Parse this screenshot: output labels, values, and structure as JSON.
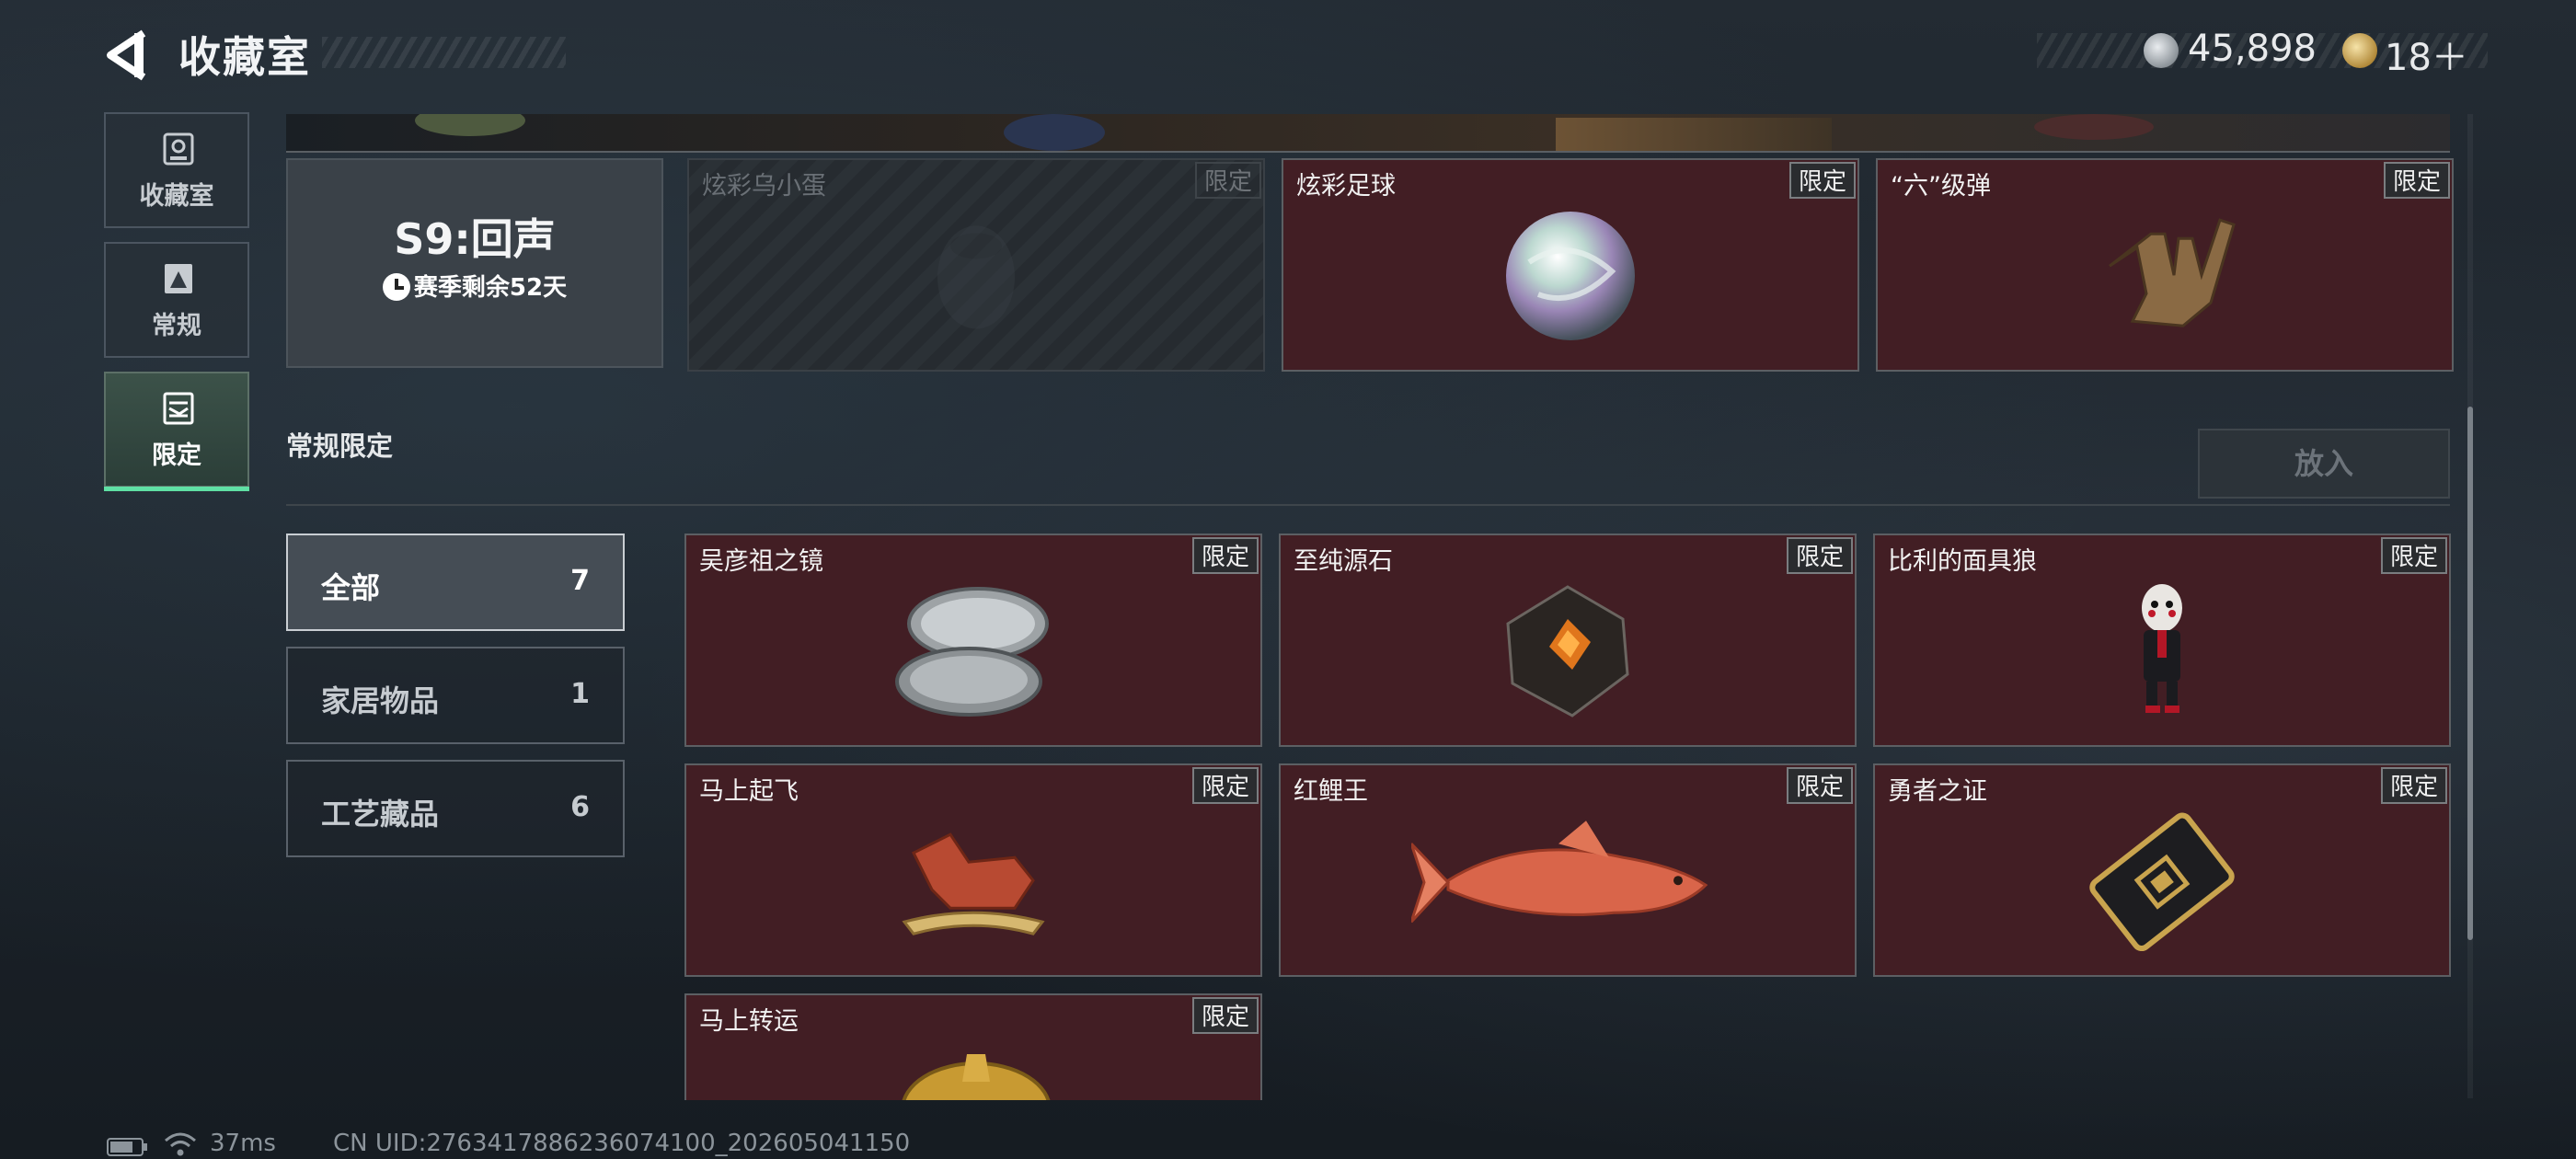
{
  "header": {
    "title": "收藏室",
    "currency": [
      {
        "icon": "silver-coin-icon",
        "value": "45,898"
      },
      {
        "icon": "gold-token-icon",
        "value": "18＋"
      }
    ]
  },
  "nav": [
    {
      "label": "收藏室",
      "icon": "collection-room-icon"
    },
    {
      "label": "常规",
      "icon": "regular-icon"
    },
    {
      "label": "限定",
      "icon": "limited-icon",
      "active": true
    }
  ],
  "season": {
    "title": "S9:回声",
    "remaining": "赛季剩余52天"
  },
  "top_cards": [
    {
      "name": "炫彩乌小蛋",
      "tag": "限定",
      "locked": true
    },
    {
      "name": "炫彩足球",
      "tag": "限定"
    },
    {
      "name": "“六”级弹",
      "tag": "限定"
    }
  ],
  "section": {
    "title": "常规限定",
    "place_button": "放入"
  },
  "categories": [
    {
      "label": "全部",
      "count": "7",
      "selected": true
    },
    {
      "label": "家居物品",
      "count": "1"
    },
    {
      "label": "工艺藏品",
      "count": "6"
    }
  ],
  "items": [
    {
      "name": "吴彦祖之镜",
      "tag": "限定"
    },
    {
      "name": "至纯源石",
      "tag": "限定"
    },
    {
      "name": "比利的面具狼",
      "tag": "限定"
    },
    {
      "name": "马上起飞",
      "tag": "限定"
    },
    {
      "name": "红鲤王",
      "tag": "限定"
    },
    {
      "name": "勇者之证",
      "tag": "限定"
    },
    {
      "name": "马上转运",
      "tag": "限定"
    }
  ],
  "footer": {
    "latency": "37ms",
    "uid": "CN UID:2763417886236074100_202605041150"
  },
  "colors": {
    "card_bg": "#421e24",
    "active_accent": "#5fe0a4"
  }
}
